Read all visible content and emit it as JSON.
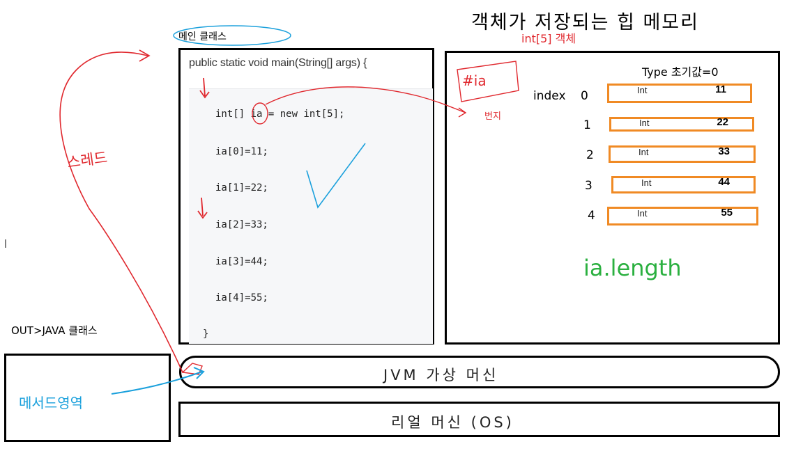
{
  "title": {
    "line1": "객체가 저장되는 힙 메모리",
    "line2": "int[5] 객체"
  },
  "main_class_label": "메인 클래스",
  "code": {
    "signature": "public static void main(String[] args) {",
    "lines": [
      "int[] ia = new int[5];",
      "ia[0]=11;",
      "ia[1]=22;",
      "ia[2]=33;",
      "ia[3]=44;",
      "ia[4]=55;"
    ],
    "closing_brace": "}"
  },
  "heap": {
    "ref_label": "#ia",
    "ref_note": "번지",
    "type_header": "Type 초기값=0",
    "index_label": "index",
    "slots": [
      {
        "index": "0",
        "type": "Int",
        "value": "11"
      },
      {
        "index": "1",
        "type": "Int",
        "value": "22"
      },
      {
        "index": "2",
        "type": "Int",
        "value": "33"
      },
      {
        "index": "3",
        "type": "Int",
        "value": "44"
      },
      {
        "index": "4",
        "type": "Int",
        "value": "55"
      }
    ],
    "length_expr": "ia.length"
  },
  "thread_label": "스레드",
  "method_area_title": "OUT>JAVA 클래스",
  "method_area_label": "메서드영역",
  "jvm_label": "JVM 가상 머신",
  "os_label": "리얼 머신 (OS)",
  "colors": {
    "red": "#e0282e",
    "blue": "#1aa0dc",
    "green": "#2bb040",
    "orange": "#f08a24",
    "ink": "#000000"
  }
}
